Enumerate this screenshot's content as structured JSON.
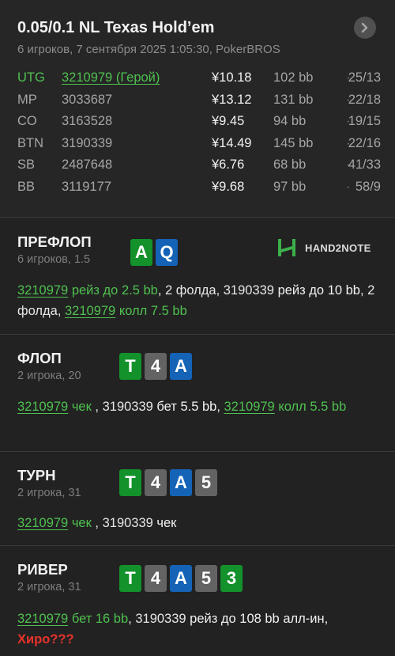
{
  "header": {
    "title": "0.05/0.1 NL Texas Hold’em",
    "subtitle": "6 игроков, 7 сентября 2025 1:05:30, PokerBROS"
  },
  "players": [
    {
      "position": "UTG",
      "id": "3210979 (Герой)",
      "stack": "¥10.18",
      "bb": "102 bb",
      "sep": "·",
      "stat": "25/13",
      "hero": true
    },
    {
      "position": "MP",
      "id": "3033687",
      "stack": "¥13.12",
      "bb": "131 bb",
      "sep": "·",
      "stat": "22/18",
      "hero": false
    },
    {
      "position": "CO",
      "id": "3163528",
      "stack": "¥9.45",
      "bb": "94 bb",
      "sep": "·",
      "stat": "19/15",
      "hero": false
    },
    {
      "position": "BTN",
      "id": "3190339",
      "stack": "¥14.49",
      "bb": "145 bb",
      "sep": "·",
      "stat": "22/16",
      "hero": false
    },
    {
      "position": "SB",
      "id": "2487648",
      "stack": "¥6.76",
      "bb": "68 bb",
      "sep": "·",
      "stat": "41/33",
      "hero": false
    },
    {
      "position": "BB",
      "id": "3119177",
      "stack": "¥9.68",
      "bb": "97 bb",
      "sep": "·",
      "stat": "58/9",
      "hero": false
    }
  ],
  "logo": {
    "text": "HAND2NOTE"
  },
  "streets": {
    "preflop": {
      "name": "ПРЕФЛОП",
      "sub": "6 игроков, 1.5",
      "cards": [
        {
          "rank": "A",
          "color": "#13912b"
        },
        {
          "rank": "Q",
          "color": "#1463b7"
        }
      ],
      "a": {
        "p1": "3210979",
        "t1": " рейз до 2.5 bb",
        "t2": ", 2 фолда, ",
        "p2": "3190339",
        "t3": " рейз до 10 bb",
        "t4": ", 2 фолда, ",
        "p3": "3210979",
        "t5": " колл 7.5 bb"
      }
    },
    "flop": {
      "name": "ФЛОП",
      "sub": "2 игрока, 20",
      "cards": [
        {
          "rank": "T",
          "color": "#13912b"
        },
        {
          "rank": "4",
          "color": "#636363"
        },
        {
          "rank": "A",
          "color": "#1463b7"
        }
      ],
      "a": {
        "p1": "3210979",
        "t1": " чек ",
        "t2": ", 3190339",
        "t3": " бет 5.5 bb",
        "t4": ", ",
        "p2": "3210979",
        "t5": " колл 5.5 bb"
      }
    },
    "turn": {
      "name": "ТУРН",
      "sub": "2 игрока, 31",
      "cards": [
        {
          "rank": "T",
          "color": "#13912b"
        },
        {
          "rank": "4",
          "color": "#636363"
        },
        {
          "rank": "A",
          "color": "#1463b7"
        },
        {
          "rank": "5",
          "color": "#636363"
        }
      ],
      "a": {
        "p1": "3210979",
        "t1": " чек ",
        "t2": ", 3190339",
        "t3": " чек"
      }
    },
    "river": {
      "name": "РИВЕР",
      "sub": "2 игрока, 31",
      "cards": [
        {
          "rank": "T",
          "color": "#13912b"
        },
        {
          "rank": "4",
          "color": "#636363"
        },
        {
          "rank": "A",
          "color": "#1463b7"
        },
        {
          "rank": "5",
          "color": "#636363"
        },
        {
          "rank": "3",
          "color": "#13912b"
        }
      ],
      "a": {
        "p1": "3210979",
        "t1": " бет 16 bb",
        "t2": ", 3190339",
        "t3": " рейз до 108 bb алл-ин,",
        "t4": "Хиро???"
      }
    }
  }
}
